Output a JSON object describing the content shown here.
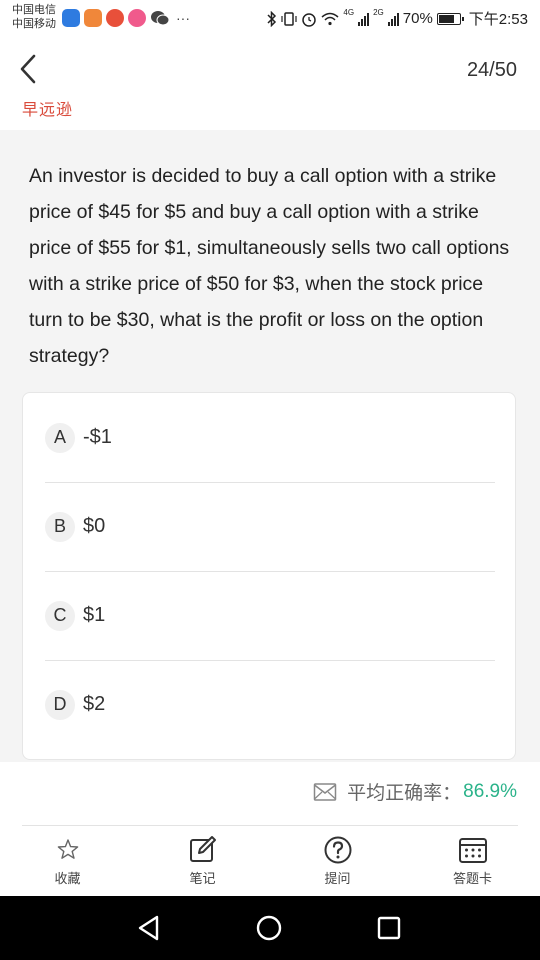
{
  "status_bar": {
    "carrier_1": "中国电信",
    "carrier_2": "中国移动",
    "more": "···",
    "net_4g": "4G",
    "net_2g": "2G",
    "battery": "70%",
    "time": "下午2:53"
  },
  "header": {
    "progress": "24/50",
    "brand": "早远逊"
  },
  "question": {
    "text": "An investor is decided to buy a call option with a strike price of $45 for $5 and buy a call option with a strike price of $55 for $1, simultaneously sells two call options with a strike price of $50 for $3, when the stock price turn to be $30, what is the profit or loss on the option strategy?",
    "options": [
      {
        "letter": "A",
        "text": "-$1"
      },
      {
        "letter": "B",
        "text": "$0"
      },
      {
        "letter": "C",
        "text": "$1"
      },
      {
        "letter": "D",
        "text": "$2"
      }
    ]
  },
  "accuracy": {
    "label": "平均正确率：",
    "value": "86.9%",
    "value_color": "#2bb38a"
  },
  "toolbar": {
    "items": [
      {
        "label": "收藏",
        "icon": "star-icon"
      },
      {
        "label": "笔记",
        "icon": "edit-note-icon"
      },
      {
        "label": "提问",
        "icon": "question-icon"
      },
      {
        "label": "答题卡",
        "icon": "answer-card-icon"
      }
    ]
  },
  "colors": {
    "brand_red": "#d94a3a",
    "accent_green": "#2bb38a",
    "page_bg": "#f4f4f4"
  }
}
